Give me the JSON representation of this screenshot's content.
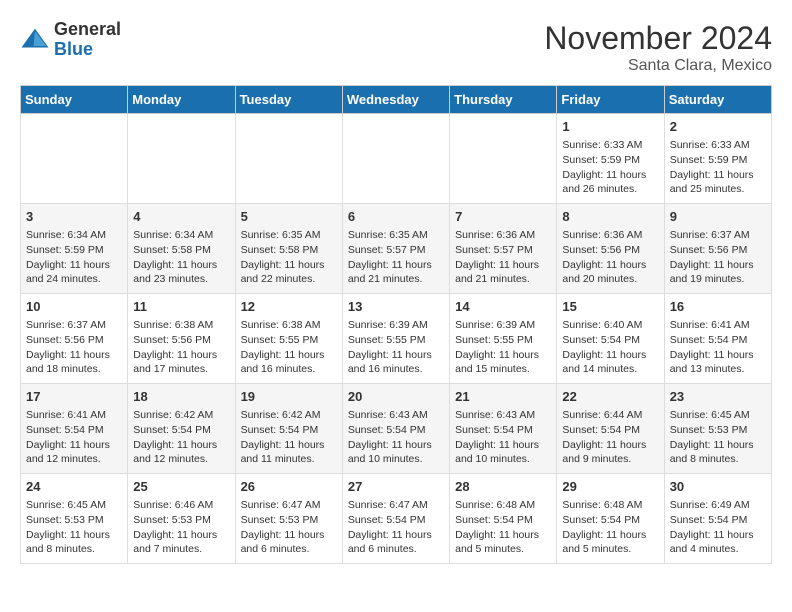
{
  "header": {
    "logo_general": "General",
    "logo_blue": "Blue",
    "month_title": "November 2024",
    "subtitle": "Santa Clara, Mexico"
  },
  "weekdays": [
    "Sunday",
    "Monday",
    "Tuesday",
    "Wednesday",
    "Thursday",
    "Friday",
    "Saturday"
  ],
  "weeks": [
    [
      {
        "day": "",
        "info": ""
      },
      {
        "day": "",
        "info": ""
      },
      {
        "day": "",
        "info": ""
      },
      {
        "day": "",
        "info": ""
      },
      {
        "day": "",
        "info": ""
      },
      {
        "day": "1",
        "info": "Sunrise: 6:33 AM\nSunset: 5:59 PM\nDaylight: 11 hours and 26 minutes."
      },
      {
        "day": "2",
        "info": "Sunrise: 6:33 AM\nSunset: 5:59 PM\nDaylight: 11 hours and 25 minutes."
      }
    ],
    [
      {
        "day": "3",
        "info": "Sunrise: 6:34 AM\nSunset: 5:59 PM\nDaylight: 11 hours and 24 minutes."
      },
      {
        "day": "4",
        "info": "Sunrise: 6:34 AM\nSunset: 5:58 PM\nDaylight: 11 hours and 23 minutes."
      },
      {
        "day": "5",
        "info": "Sunrise: 6:35 AM\nSunset: 5:58 PM\nDaylight: 11 hours and 22 minutes."
      },
      {
        "day": "6",
        "info": "Sunrise: 6:35 AM\nSunset: 5:57 PM\nDaylight: 11 hours and 21 minutes."
      },
      {
        "day": "7",
        "info": "Sunrise: 6:36 AM\nSunset: 5:57 PM\nDaylight: 11 hours and 21 minutes."
      },
      {
        "day": "8",
        "info": "Sunrise: 6:36 AM\nSunset: 5:56 PM\nDaylight: 11 hours and 20 minutes."
      },
      {
        "day": "9",
        "info": "Sunrise: 6:37 AM\nSunset: 5:56 PM\nDaylight: 11 hours and 19 minutes."
      }
    ],
    [
      {
        "day": "10",
        "info": "Sunrise: 6:37 AM\nSunset: 5:56 PM\nDaylight: 11 hours and 18 minutes."
      },
      {
        "day": "11",
        "info": "Sunrise: 6:38 AM\nSunset: 5:56 PM\nDaylight: 11 hours and 17 minutes."
      },
      {
        "day": "12",
        "info": "Sunrise: 6:38 AM\nSunset: 5:55 PM\nDaylight: 11 hours and 16 minutes."
      },
      {
        "day": "13",
        "info": "Sunrise: 6:39 AM\nSunset: 5:55 PM\nDaylight: 11 hours and 16 minutes."
      },
      {
        "day": "14",
        "info": "Sunrise: 6:39 AM\nSunset: 5:55 PM\nDaylight: 11 hours and 15 minutes."
      },
      {
        "day": "15",
        "info": "Sunrise: 6:40 AM\nSunset: 5:54 PM\nDaylight: 11 hours and 14 minutes."
      },
      {
        "day": "16",
        "info": "Sunrise: 6:41 AM\nSunset: 5:54 PM\nDaylight: 11 hours and 13 minutes."
      }
    ],
    [
      {
        "day": "17",
        "info": "Sunrise: 6:41 AM\nSunset: 5:54 PM\nDaylight: 11 hours and 12 minutes."
      },
      {
        "day": "18",
        "info": "Sunrise: 6:42 AM\nSunset: 5:54 PM\nDaylight: 11 hours and 12 minutes."
      },
      {
        "day": "19",
        "info": "Sunrise: 6:42 AM\nSunset: 5:54 PM\nDaylight: 11 hours and 11 minutes."
      },
      {
        "day": "20",
        "info": "Sunrise: 6:43 AM\nSunset: 5:54 PM\nDaylight: 11 hours and 10 minutes."
      },
      {
        "day": "21",
        "info": "Sunrise: 6:43 AM\nSunset: 5:54 PM\nDaylight: 11 hours and 10 minutes."
      },
      {
        "day": "22",
        "info": "Sunrise: 6:44 AM\nSunset: 5:54 PM\nDaylight: 11 hours and 9 minutes."
      },
      {
        "day": "23",
        "info": "Sunrise: 6:45 AM\nSunset: 5:53 PM\nDaylight: 11 hours and 8 minutes."
      }
    ],
    [
      {
        "day": "24",
        "info": "Sunrise: 6:45 AM\nSunset: 5:53 PM\nDaylight: 11 hours and 8 minutes."
      },
      {
        "day": "25",
        "info": "Sunrise: 6:46 AM\nSunset: 5:53 PM\nDaylight: 11 hours and 7 minutes."
      },
      {
        "day": "26",
        "info": "Sunrise: 6:47 AM\nSunset: 5:53 PM\nDaylight: 11 hours and 6 minutes."
      },
      {
        "day": "27",
        "info": "Sunrise: 6:47 AM\nSunset: 5:54 PM\nDaylight: 11 hours and 6 minutes."
      },
      {
        "day": "28",
        "info": "Sunrise: 6:48 AM\nSunset: 5:54 PM\nDaylight: 11 hours and 5 minutes."
      },
      {
        "day": "29",
        "info": "Sunrise: 6:48 AM\nSunset: 5:54 PM\nDaylight: 11 hours and 5 minutes."
      },
      {
        "day": "30",
        "info": "Sunrise: 6:49 AM\nSunset: 5:54 PM\nDaylight: 11 hours and 4 minutes."
      }
    ]
  ]
}
